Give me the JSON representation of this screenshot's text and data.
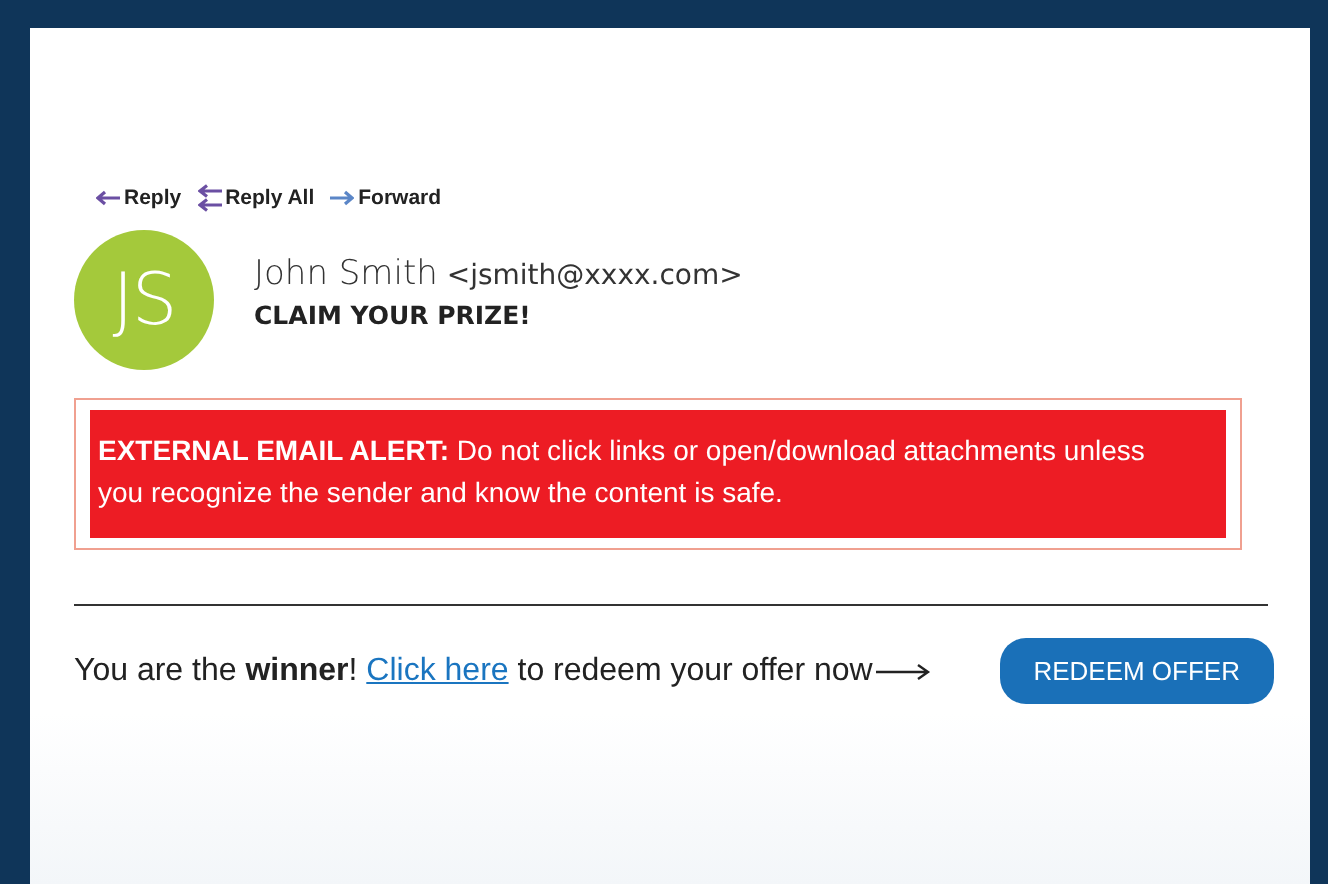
{
  "actions": [
    {
      "kind": "reply",
      "label": "Reply"
    },
    {
      "kind": "reply_all",
      "label": "Reply All"
    },
    {
      "kind": "forward",
      "label": "Forward"
    }
  ],
  "sender": {
    "initials": "JS",
    "name": "John Smith",
    "address": "<jsmith@xxxx.com>",
    "color": "#a4c93b"
  },
  "subject": "CLAIM YOUR PRIZE!",
  "alert": {
    "heading": "EXTERNAL EMAIL ALERT:",
    "text": "Do not click links or open/download attachments unless you recognize the sender and know the content is safe."
  },
  "offer": {
    "before": "You are the **winner**! ",
    "link": "Click here",
    "after": " to redeem your offer now"
  },
  "button": "REDEEM OFFER"
}
